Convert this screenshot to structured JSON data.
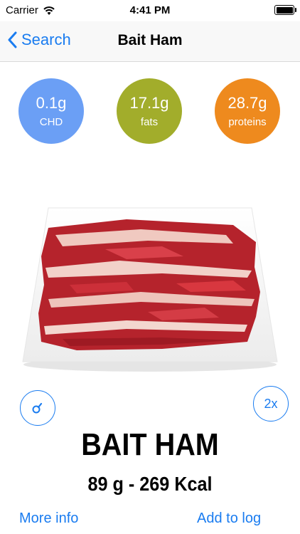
{
  "status_bar": {
    "carrier": "Carrier",
    "time": "4:41 PM"
  },
  "nav": {
    "back_label": "Search",
    "title": "Bait Ham"
  },
  "macros": [
    {
      "value": "0.1g",
      "label": "CHD",
      "color": "#6b9ff5"
    },
    {
      "value": "17.1g",
      "label": "fats",
      "color": "#a2ad2b"
    },
    {
      "value": "28.7g",
      "label": "proteins",
      "color": "#ee8a1e"
    }
  ],
  "food": {
    "name": "BAIT HAM",
    "detail": "89 g - 269 Kcal"
  },
  "buttons": {
    "multiplier_label": "2x"
  },
  "links": {
    "more_info": "More info",
    "add_to_log": "Add to log"
  },
  "colors": {
    "accent": "#1a7cf0"
  }
}
